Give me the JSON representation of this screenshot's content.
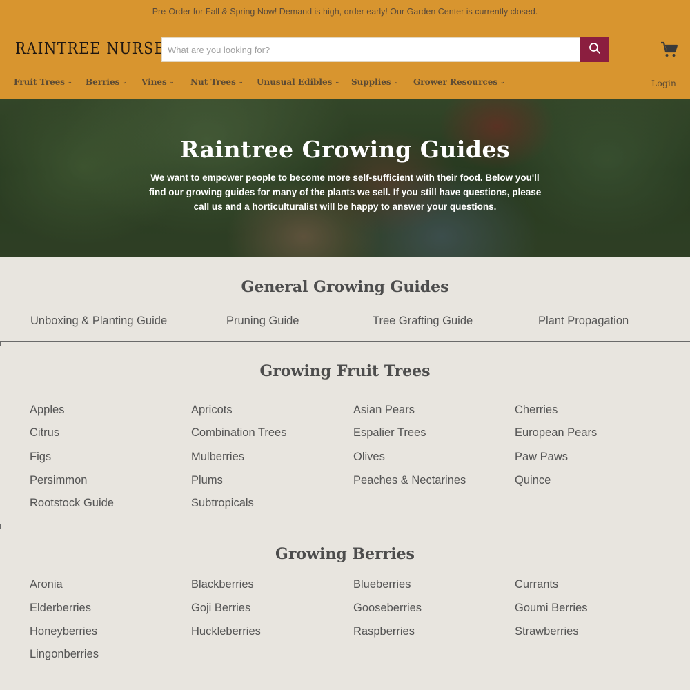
{
  "announcement": "Pre-Order for Fall & Spring Now! Demand is high, order early! Our Garden Center is currently closed.",
  "logo": "RAINTREE NURSERY",
  "search": {
    "placeholder": "What are you looking for?"
  },
  "icons": {
    "search": "search-icon",
    "cart": "cart-icon",
    "chevron": "chevron-down-icon"
  },
  "colors": {
    "header": "#d8952f",
    "search_button": "#8b1e3f",
    "background": "#e8e5df"
  },
  "nav": {
    "items": [
      {
        "label": "Fruit Trees"
      },
      {
        "label": "Berries"
      },
      {
        "label": "Vines"
      },
      {
        "label": "Nut Trees"
      },
      {
        "label": "Unusual Edibles"
      },
      {
        "label": "Supplies"
      },
      {
        "label": "Grower Resources"
      }
    ],
    "login": "Login"
  },
  "hero": {
    "title": "Raintree Growing Guides",
    "text": "We want to empower people to become more self-sufficient with their food. Below you'll find our growing guides for many of the plants we sell. If you still have questions, please call us and a horticulturalist will be happy to answer your questions."
  },
  "general": {
    "title": "General Growing Guides",
    "links": [
      "Unboxing & Planting Guide",
      "Pruning Guide",
      "Tree Grafting Guide",
      "Plant Propagation"
    ]
  },
  "fruit_trees": {
    "title": "Growing Fruit Trees",
    "links": [
      "Apples",
      "Apricots",
      "Asian Pears",
      "Cherries",
      "Citrus",
      "Combination Trees",
      "Espalier Trees",
      "European Pears",
      "Figs",
      "Mulberries",
      "Olives",
      "Paw Paws",
      "Persimmon",
      "Plums",
      "Peaches & Nectarines",
      "Quince",
      "Rootstock Guide",
      "Subtropicals"
    ]
  },
  "berries": {
    "title": "Growing Berries",
    "links": [
      "Aronia",
      "Blackberries",
      "Blueberries",
      "Currants",
      "Elderberries",
      "Goji Berries",
      "Gooseberries",
      "Goumi Berries",
      "Honeyberries",
      "Huckleberries",
      "Raspberries",
      "Strawberries",
      "Lingonberries"
    ]
  }
}
